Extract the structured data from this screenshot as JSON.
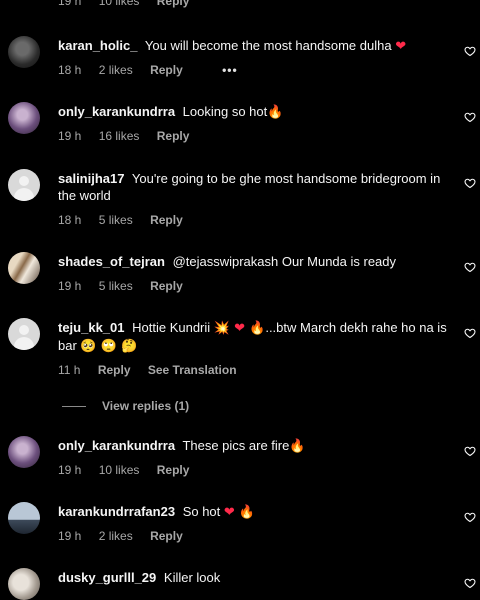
{
  "top_partial": {
    "time": "19 h",
    "likes": "10 likes",
    "reply": "Reply"
  },
  "comments": [
    {
      "username": "karan_holic_",
      "text": "You will become the most handsome dulha",
      "emoji": "❤",
      "time": "18 h",
      "likes": "2 likes",
      "reply": "Reply",
      "more": "•••"
    },
    {
      "username": "only_karankundrra",
      "text": "Looking so hot",
      "emoji": "🔥",
      "time": "19 h",
      "likes": "16 likes",
      "reply": "Reply"
    },
    {
      "username": "salinijha17",
      "text": "You're going to be ghe most handsome bridegroom in the world",
      "time": "18 h",
      "likes": "5 likes",
      "reply": "Reply"
    },
    {
      "username": "shades_of_tejran",
      "text": "@tejasswiprakash Our Munda is ready",
      "time": "19 h",
      "likes": "5 likes",
      "reply": "Reply"
    },
    {
      "username": "teju_kk_01",
      "text": "Hottie Kundrii",
      "emoji": "💥 ❤ 🔥",
      "text2": "...btw March dekh rahe ho na is bar",
      "emoji2": "🥺 🙄 🤔",
      "time": "11 h",
      "reply": "Reply",
      "translate": "See Translation",
      "view_replies": "View replies (1)"
    },
    {
      "username": "only_karankundrra",
      "text": "These pics are fire",
      "emoji": "🔥",
      "time": "19 h",
      "likes": "10 likes",
      "reply": "Reply"
    },
    {
      "username": "karankundrrafan23",
      "text": "So hot",
      "emoji": "❤ 🔥",
      "time": "19 h",
      "likes": "2 likes",
      "reply": "Reply"
    },
    {
      "username": "dusky_gurlll_29",
      "text": "Killer look"
    }
  ],
  "icons": {
    "like": "heart-outline-icon",
    "avatar_default": "default-avatar-icon"
  },
  "colors": {
    "background": "#000000",
    "text": "#f5f5f5",
    "muted": "#a8a8a8",
    "heart": "#ff2a4a",
    "fire": "#ff8a1a"
  }
}
